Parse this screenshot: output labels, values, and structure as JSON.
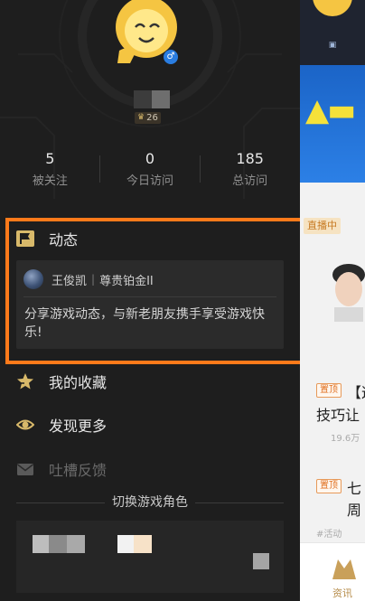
{
  "profile": {
    "gender_symbol": "♂",
    "level": "26"
  },
  "stats": [
    {
      "value": "5",
      "label": "被关注"
    },
    {
      "value": "0",
      "label": "今日访问"
    },
    {
      "value": "185",
      "label": "总访问"
    }
  ],
  "dynamics": {
    "title": "动态",
    "user_name": "王俊凯",
    "separator": "|",
    "rank": "尊贵铂金II",
    "message": "分享游戏动态，与新老朋友携手享受游戏快乐!"
  },
  "menu": [
    {
      "label": "我的收藏",
      "icon": "star-icon"
    },
    {
      "label": "发现更多",
      "icon": "eye-icon"
    },
    {
      "label": "吐槽反馈",
      "icon": "mail-icon",
      "disabled": true
    }
  ],
  "switch_role": {
    "label": "切换游戏角色"
  },
  "background_page": {
    "live_tag": "直播中",
    "items": [
      {
        "tag": "置顶",
        "title": "【这",
        "title2": "技巧让",
        "meta": "19.6万"
      },
      {
        "tag": "置顶",
        "title": "七周"
      }
    ],
    "hashtag": "#活动",
    "bottom_tab": "资讯"
  },
  "colors": {
    "drawer_bg": "#1e1e1e",
    "highlight": "#ff7a1a",
    "accent_gold": "#d8b96a"
  }
}
